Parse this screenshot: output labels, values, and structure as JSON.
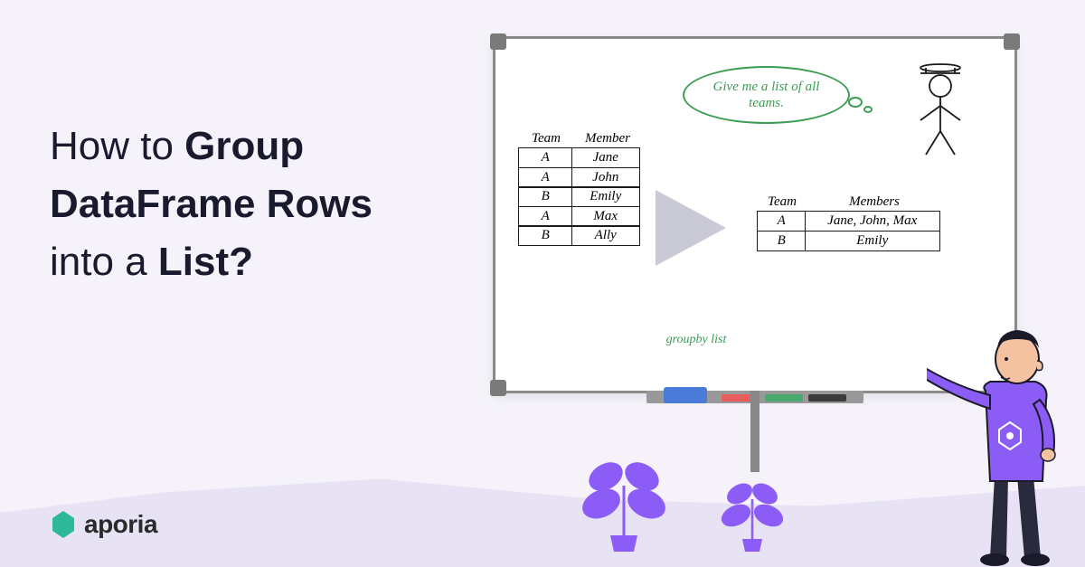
{
  "title": {
    "line1_plain": "How to ",
    "line1_bold": "Group",
    "line2_bold": "DataFrame Rows",
    "line3_plain": "into a ",
    "line3_bold": "List?"
  },
  "logo": {
    "text": "aporia"
  },
  "whiteboard": {
    "speech": "Give me a list of all teams.",
    "funnel_label": "groupby list",
    "table_input": {
      "headers": [
        "Team",
        "Member"
      ],
      "rows": [
        [
          "A",
          "Jane"
        ],
        [
          "A",
          "John"
        ],
        [
          "B",
          "Emily"
        ],
        [
          "A",
          "Max"
        ],
        [
          "B",
          "Ally"
        ]
      ]
    },
    "table_output": {
      "headers": [
        "Team",
        "Members"
      ],
      "rows": [
        [
          "A",
          "Jane, John, Max"
        ],
        [
          "B",
          "Emily"
        ]
      ]
    }
  },
  "colors": {
    "accent_green": "#3a9d52",
    "accent_purple": "#8b5cf6",
    "logo_teal": "#2eb89a"
  }
}
